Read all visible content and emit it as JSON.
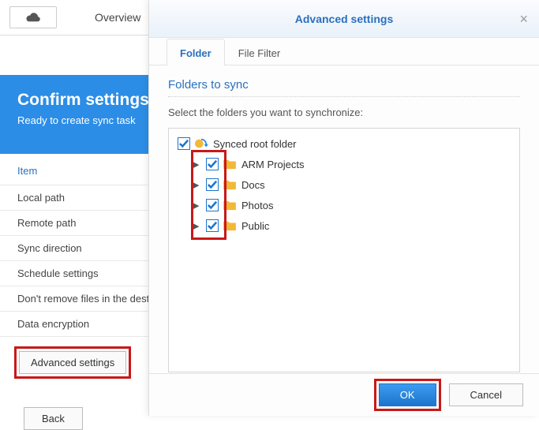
{
  "bg": {
    "tab_overview": "Overview",
    "hero_title": "Confirm settings",
    "hero_sub": "Ready to create sync task",
    "table_header": "Item",
    "rows": [
      "Local path",
      "Remote path",
      "Sync direction",
      "Schedule settings",
      "Don't remove files in the destination",
      "Data encryption"
    ],
    "advanced_btn": "Advanced settings",
    "back_btn": "Back"
  },
  "modal": {
    "title": "Advanced settings",
    "tabs": {
      "folder": "Folder",
      "file_filter": "File Filter"
    },
    "section_title": "Folders to sync",
    "hint": "Select the folders you want to synchronize:",
    "tree": {
      "root": "Synced root folder",
      "children": [
        "ARM Projects",
        "Docs",
        "Photos",
        "Public"
      ]
    },
    "ok": "OK",
    "cancel": "Cancel"
  }
}
